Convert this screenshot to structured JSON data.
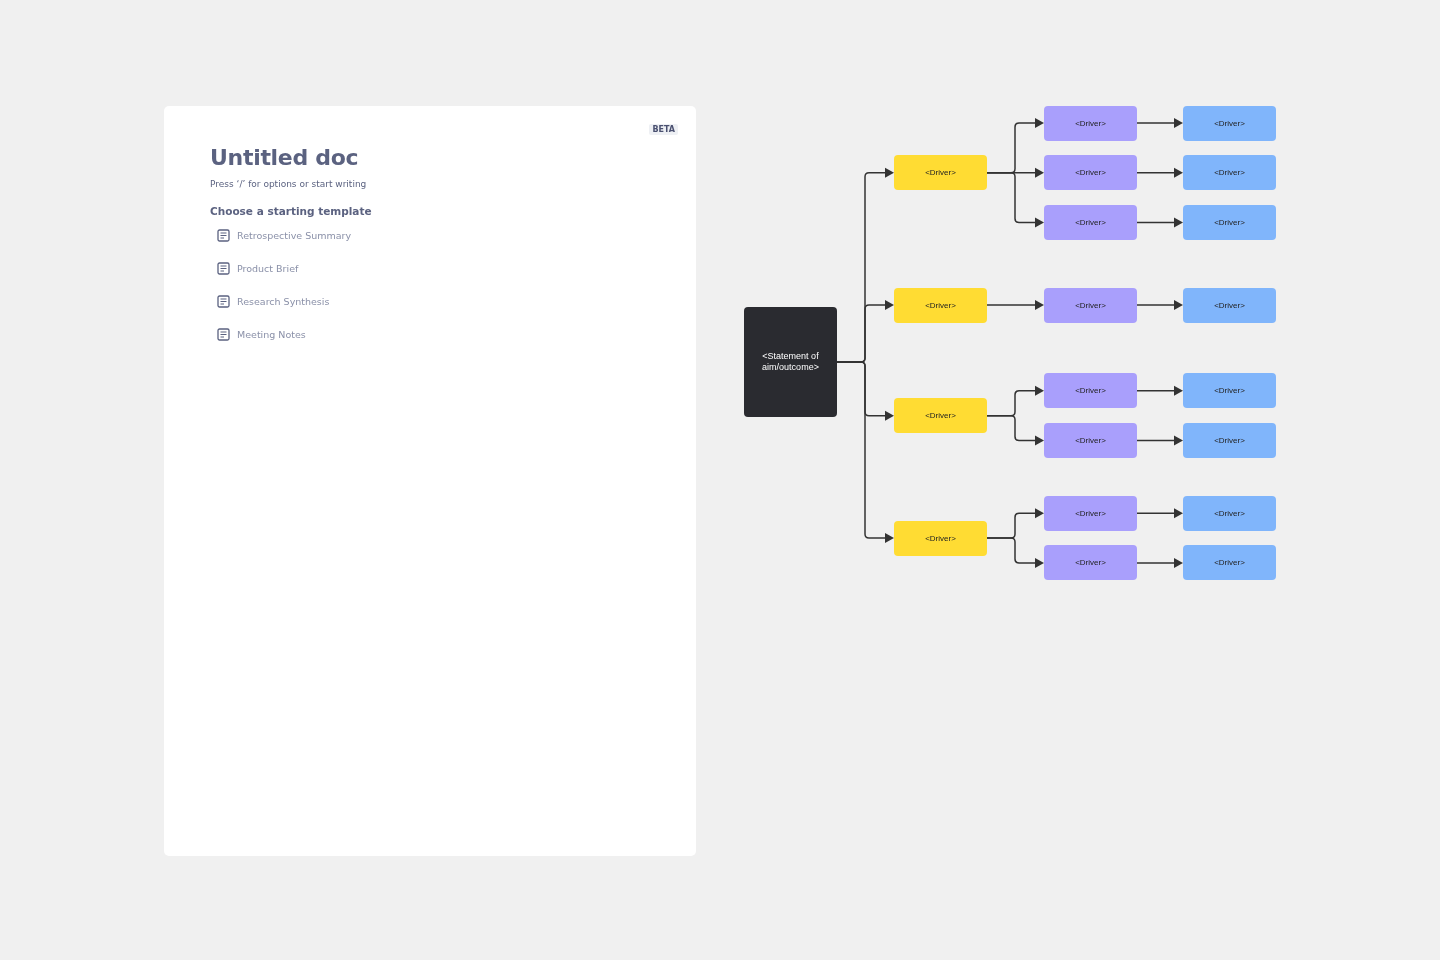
{
  "document": {
    "badge": "BETA",
    "title": "Untitled doc",
    "hint": "Press ‘/’ for options or start writing",
    "section_heading": "Choose a starting template",
    "templates": [
      {
        "label": "Retrospective Summary"
      },
      {
        "label": "Product Brief"
      },
      {
        "label": "Research Synthesis"
      },
      {
        "label": "Meeting Notes"
      }
    ]
  },
  "diagram": {
    "root": {
      "label": "<Statement of aim/outcome>",
      "children": [
        {
          "label": "<Driver>",
          "children": [
            {
              "label": "<Driver>",
              "children": [
                {
                  "label": "<Driver>"
                }
              ]
            },
            {
              "label": "<Driver>",
              "children": [
                {
                  "label": "<Driver>"
                }
              ]
            },
            {
              "label": "<Driver>",
              "children": [
                {
                  "label": "<Driver>"
                }
              ]
            }
          ]
        },
        {
          "label": "<Driver>",
          "children": [
            {
              "label": "<Driver>",
              "children": [
                {
                  "label": "<Driver>"
                }
              ]
            }
          ]
        },
        {
          "label": "<Driver>",
          "children": [
            {
              "label": "<Driver>",
              "children": [
                {
                  "label": "<Driver>"
                }
              ]
            },
            {
              "label": "<Driver>",
              "children": [
                {
                  "label": "<Driver>"
                }
              ]
            }
          ]
        },
        {
          "label": "<Driver>",
          "children": [
            {
              "label": "<Driver>",
              "children": [
                {
                  "label": "<Driver>"
                }
              ]
            },
            {
              "label": "<Driver>",
              "children": [
                {
                  "label": "<Driver>"
                }
              ]
            }
          ]
        }
      ]
    }
  }
}
